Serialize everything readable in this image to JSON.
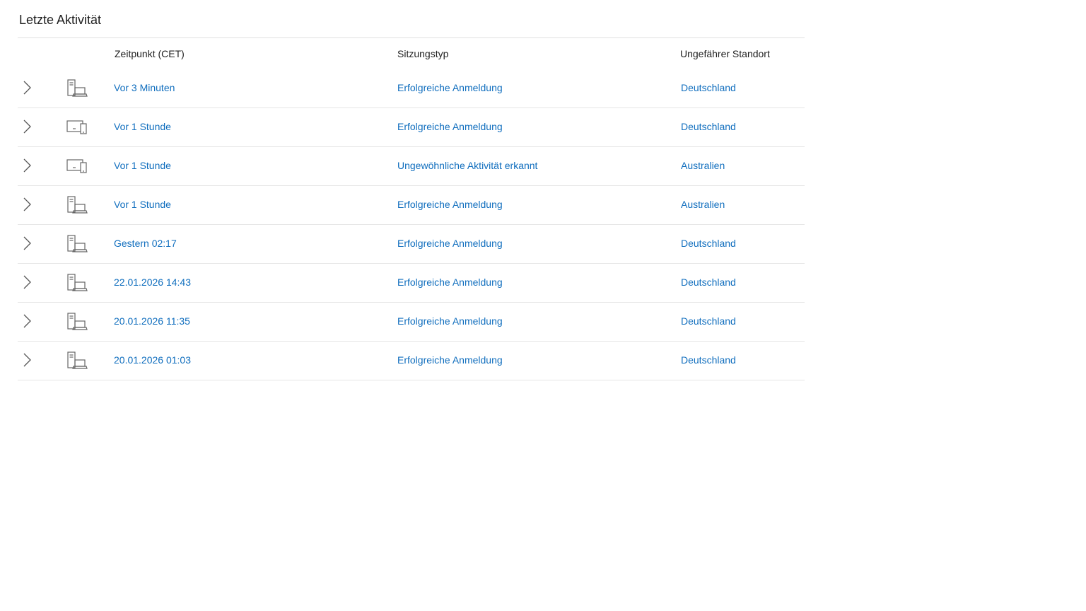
{
  "section": {
    "title": "Letzte Aktivität"
  },
  "table": {
    "headers": {
      "time": "Zeitpunkt (CET)",
      "type": "Sitzungstyp",
      "location": "Ungefährer Standort"
    },
    "rows": [
      {
        "icon": "desktop-laptop-icon",
        "time": "Vor 3 Minuten",
        "type": "Erfolgreiche Anmeldung",
        "location": "Deutschland"
      },
      {
        "icon": "monitor-phone-icon",
        "time": "Vor 1 Stunde",
        "type": "Erfolgreiche Anmeldung",
        "location": "Deutschland"
      },
      {
        "icon": "monitor-phone-icon",
        "time": "Vor 1 Stunde",
        "type": "Ungewöhnliche Aktivität erkannt",
        "location": "Australien"
      },
      {
        "icon": "desktop-laptop-icon",
        "time": "Vor 1 Stunde",
        "type": "Erfolgreiche Anmeldung",
        "location": "Australien"
      },
      {
        "icon": "desktop-laptop-icon",
        "time": "Gestern 02:17",
        "type": "Erfolgreiche Anmeldung",
        "location": "Deutschland"
      },
      {
        "icon": "desktop-laptop-icon",
        "time": "22.01.2026 14:43",
        "type": "Erfolgreiche Anmeldung",
        "location": "Deutschland"
      },
      {
        "icon": "desktop-laptop-icon",
        "time": "20.01.2026 11:35",
        "type": "Erfolgreiche Anmeldung",
        "location": "Deutschland"
      },
      {
        "icon": "desktop-laptop-icon",
        "time": "20.01.2026 01:03",
        "type": "Erfolgreiche Anmeldung",
        "location": "Deutschland"
      }
    ]
  },
  "colors": {
    "link": "#106ebe",
    "text": "#1f1f1f",
    "icon": "#666666",
    "divider": "#e6e6e6"
  }
}
